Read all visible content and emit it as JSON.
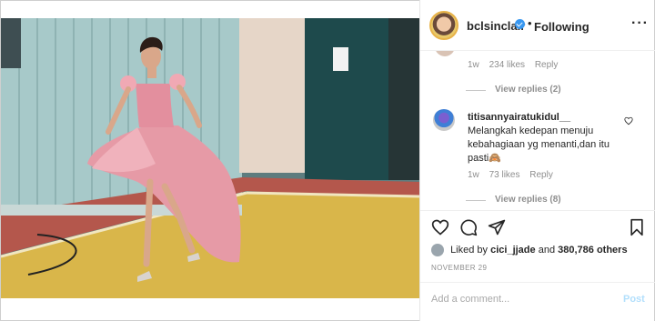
{
  "post": {
    "username": "bclsinclair",
    "separator": "•",
    "follow_state": "Following",
    "more_icon": "more-horizontal-icon"
  },
  "comments": [
    {
      "time": "1w",
      "likes": "234 likes",
      "reply_label": "Reply",
      "view_replies": "View replies (2)"
    },
    {
      "username": "titisannyairatukidul__",
      "text": "Melangkah kedepan menuju kebahagiaan yg menanti,dan itu pasti🙈",
      "time": "1w",
      "likes": "73 likes",
      "reply_label": "Reply",
      "view_replies": "View replies (8)"
    }
  ],
  "actions": {
    "like_icon": "heart-icon",
    "comment_icon": "comment-icon",
    "share_icon": "share-icon",
    "save_icon": "bookmark-icon"
  },
  "likes_summary": {
    "prefix": "Liked by",
    "user": "cici_jjade",
    "conjunction": "and",
    "count": "380,786 others"
  },
  "date": "NOVEMBER 29",
  "add_comment": {
    "placeholder": "Add a comment...",
    "post_label": "Post"
  },
  "colors": {
    "accent_blue": "#3897f0",
    "post_disabled": "#b2dffc",
    "muted": "#8e8e8e",
    "dress_pink": "#e69aa6"
  }
}
